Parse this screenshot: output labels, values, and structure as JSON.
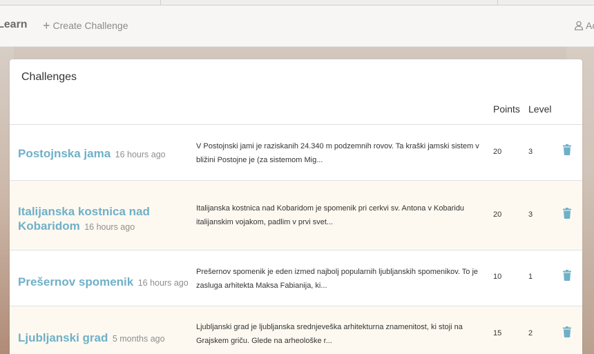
{
  "navbar": {
    "brand": "Learn",
    "create_label": "Create Challenge",
    "account_label": "Ac"
  },
  "card": {
    "title": "Challenges",
    "columns": {
      "points": "Points",
      "level": "Level"
    }
  },
  "challenges": [
    {
      "title": "Postojnska jama",
      "time": "16 hours ago",
      "description": "V Postojnski jami je raziskanih 24.340 m podzemnih rovov. Ta kraški jamski sistem v bližini Postojne je (za sistemom Mig...",
      "points": "20",
      "level": "3"
    },
    {
      "title": "Italijanska kostnica nad Kobaridom",
      "time": "16 hours ago",
      "description": "Italijanska kostnica nad Kobaridom je spomenik pri cerkvi sv. Antona v Kobaridu italijanskim vojakom, padlim v prvi svet...",
      "points": "20",
      "level": "3"
    },
    {
      "title": "Prešernov spomenik",
      "time": "16 hours ago",
      "description": "Prešernov spomenik je eden izmed najbolj popularnih ljubljanskih spomenikov. To je zasluga arhitekta Maksa Fabianija, ki...",
      "points": "10",
      "level": "1"
    },
    {
      "title": "Ljubljanski grad",
      "time": "5 months ago",
      "description": "Ljubljanski grad je ljubljanska srednjeveška arhitekturna znamenitost, ki stoji na Grajskem griču. Glede na arheološke r...",
      "points": "15",
      "level": "2"
    }
  ],
  "colors": {
    "title_accent": "#6fb0c8",
    "trash_icon": "#6fb0c8",
    "alt_row_bg": "#fdf9f0"
  }
}
